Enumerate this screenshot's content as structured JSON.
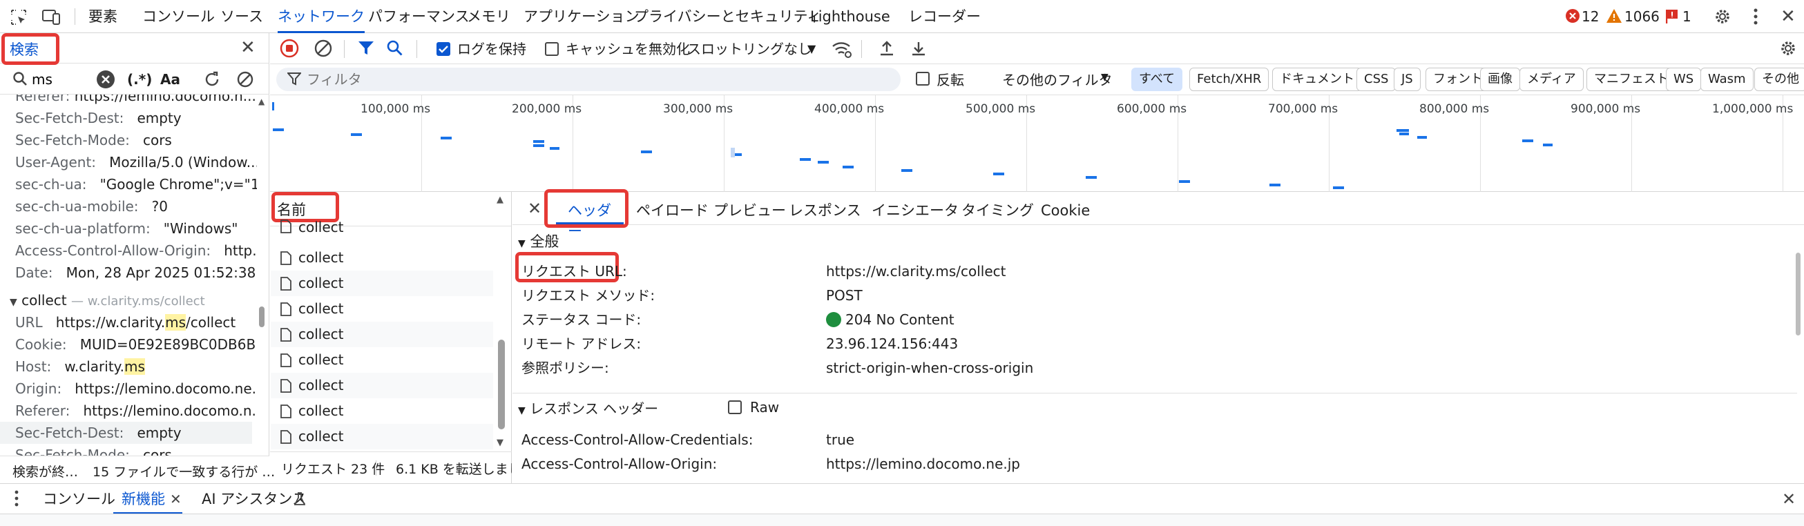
{
  "top_tabs": [
    "要素",
    "コンソール",
    "ソース",
    "ネットワーク",
    "パフォーマンス",
    "メモリ",
    "アプリケーション",
    "プライバシーとセキュリティ",
    "Lighthouse",
    "レコーダー"
  ],
  "status": {
    "errors": "12",
    "warnings": "1066",
    "issues": "1"
  },
  "search": {
    "title": "検索",
    "query": "ms",
    "regex_label": "(.*)",
    "case_label": "Aa",
    "status": "検索が終…",
    "summary": "15 ファイルで一致する行が …"
  },
  "search_results": [
    {
      "k": "Referer:",
      "v": "https://lemino.docomo.n..."
    },
    {
      "k": "Sec-Fetch-Dest:",
      "v": "empty"
    },
    {
      "k": "Sec-Fetch-Mode:",
      "v": "cors"
    },
    {
      "k": "User-Agent:",
      "v": "Mozilla/5.0 (Window..."
    },
    {
      "k": "sec-ch-ua:",
      "v": "\"Google Chrome\";v=\"1..."
    },
    {
      "k": "sec-ch-ua-mobile:",
      "v": "?0"
    },
    {
      "k": "sec-ch-ua-platform:",
      "v": "\"Windows\""
    },
    {
      "k": "Access-Control-Allow-Origin:",
      "v": "http..."
    },
    {
      "k": "Date:",
      "v": "Mon, 28 Apr 2025 01:52:38 ..."
    }
  ],
  "group": {
    "name": "collect",
    "url": "— w.clarity.ms/collect"
  },
  "group_results": [
    {
      "k": "URL",
      "v": "https://w.clarity.ms/collect"
    },
    {
      "k": "Cookie:",
      "v": "MUID=0E92E89BC0DB6B..."
    },
    {
      "k": "Host:",
      "v": "w.clarity.ms"
    },
    {
      "k": "Origin:",
      "v": "https://lemino.docomo.ne...."
    },
    {
      "k": "Referer:",
      "v": "https://lemino.docomo.n..."
    },
    {
      "k": "Sec-Fetch-Dest:",
      "v": "empty"
    },
    {
      "k": "Sec-Fetch-Mode:",
      "v": "cors"
    }
  ],
  "toolbar": {
    "preserve_log": "ログを保持",
    "disable_cache": "キャッシュを無効化",
    "throttle": "スロットリングなし"
  },
  "filter": {
    "placeholder": "フィルタ",
    "invert": "反転",
    "more": "その他のフィルタ"
  },
  "filter_chips": [
    "すべて",
    "Fetch/XHR",
    "ドキュメント",
    "CSS",
    "JS",
    "フォント",
    "画像",
    "メディア",
    "マニフェスト",
    "WS",
    "Wasm",
    "その他"
  ],
  "timeline_ticks": [
    "100,000 ms",
    "200,000 ms",
    "300,000 ms",
    "400,000 ms",
    "500,000 ms",
    "600,000 ms",
    "700,000 ms",
    "800,000 ms",
    "900,000 ms",
    "1,000,000 ms"
  ],
  "list": {
    "header": "名前",
    "rows": [
      "collect",
      "collect",
      "collect",
      "collect",
      "collect",
      "collect",
      "collect",
      "collect",
      "collect"
    ]
  },
  "list_status": {
    "requests": "リクエスト 23 件",
    "transferred": "6.1 KB を転送しまし"
  },
  "detail_tabs": [
    "ヘッダー",
    "ペイロード",
    "プレビュー",
    "レスポンス",
    "イニシエータ",
    "タイミング",
    "Cookie"
  ],
  "general": {
    "title": "全般",
    "rows": [
      {
        "k": "リクエスト URL:",
        "v": "https://w.clarity.ms/collect"
      },
      {
        "k": "リクエスト メソッド:",
        "v": "POST"
      },
      {
        "k": "ステータス コード:",
        "v": "204 No Content"
      },
      {
        "k": "リモート アドレス:",
        "v": "23.96.124.156:443"
      },
      {
        "k": "参照ポリシー:",
        "v": "strict-origin-when-cross-origin"
      }
    ]
  },
  "response_headers": {
    "title": "レスポンス ヘッダー",
    "raw": "Raw",
    "rows": [
      {
        "k": "Access-Control-Allow-Credentials:",
        "v": "true"
      },
      {
        "k": "Access-Control-Allow-Origin:",
        "v": "https://lemino.docomo.ne.jp"
      }
    ]
  },
  "drawer_tabs": [
    "コンソール",
    "新機能",
    "AI アシスタンス"
  ],
  "colors": {
    "accent": "#0b57d0",
    "highlight_box": "#e53935",
    "status_ok": "#1e8e3e",
    "search_hl": "#fff3a3"
  }
}
